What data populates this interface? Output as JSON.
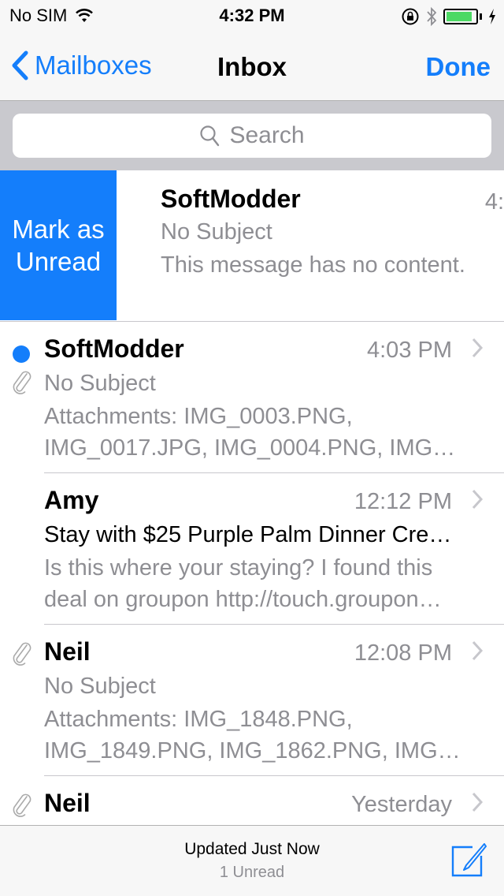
{
  "status_bar": {
    "carrier": "No SIM",
    "time": "4:32 PM",
    "battery_level": 0.9,
    "icons": [
      "wifi-icon",
      "orientation-lock-icon",
      "bluetooth-icon",
      "battery-icon",
      "charging-icon"
    ]
  },
  "nav": {
    "back_label": "Mailboxes",
    "title": "Inbox",
    "done_label": "Done"
  },
  "search": {
    "placeholder": "Search"
  },
  "swipe_action": {
    "label": "Mark as Unread"
  },
  "messages": [
    {
      "sender": "SoftModder",
      "time": "4:",
      "subject": "No Subject",
      "preview": "This message has no content.",
      "unread": false,
      "attachment": false,
      "swiped": true
    },
    {
      "sender": "SoftModder",
      "time": "4:03 PM",
      "subject": "No Subject",
      "preview": "Attachments: IMG_0003.PNG, IMG_0017.JPG, IMG_0004.PNG, IMG…",
      "unread": true,
      "attachment": true
    },
    {
      "sender": "Amy",
      "time": "12:12 PM",
      "subject": "Stay with $25 Purple Palm Dinner Cre…",
      "preview": "Is this where your staying? I found this deal on groupon http://touch.groupon…",
      "unread": false,
      "attachment": false
    },
    {
      "sender": "Neil",
      "time": "12:08 PM",
      "subject": "No Subject",
      "preview": "Attachments: IMG_1848.PNG, IMG_1849.PNG, IMG_1862.PNG, IMG…",
      "unread": false,
      "attachment": true
    },
    {
      "sender": "Neil",
      "time": "Yesterday",
      "attachment": true
    }
  ],
  "toolbar": {
    "status": "Updated Just Now",
    "unread_count": "1 Unread"
  },
  "colors": {
    "accent": "#147efb",
    "battery": "#4cd964"
  }
}
